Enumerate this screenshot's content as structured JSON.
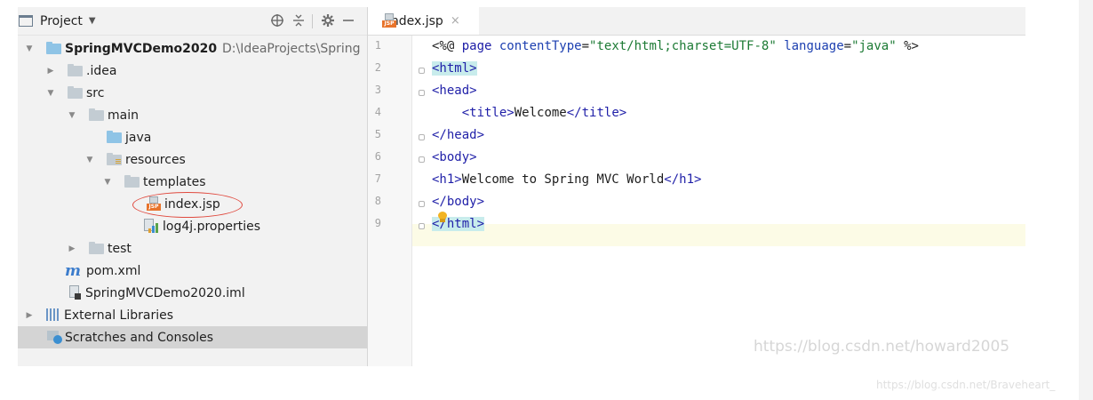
{
  "project_panel": {
    "title": "Project",
    "toolbar": [
      "locate-icon",
      "collapse-icon",
      "settings-icon",
      "hide-icon"
    ],
    "tree": [
      {
        "label": "SpringMVCDemo2020",
        "path": "D:\\IdeaProjects\\Spring",
        "type": "module-folder",
        "expanded": true
      },
      {
        "label": ".idea",
        "type": "folder",
        "expanded": false
      },
      {
        "label": "src",
        "type": "folder",
        "expanded": true
      },
      {
        "label": "main",
        "type": "folder",
        "expanded": true
      },
      {
        "label": "java",
        "type": "source-folder"
      },
      {
        "label": "resources",
        "type": "resources-folder",
        "expanded": true
      },
      {
        "label": "templates",
        "type": "folder",
        "expanded": true
      },
      {
        "label": "index.jsp",
        "type": "jsp-file"
      },
      {
        "label": "log4j.properties",
        "type": "properties-file"
      },
      {
        "label": "test",
        "type": "folder",
        "expanded": false
      },
      {
        "label": "pom.xml",
        "type": "maven-file"
      },
      {
        "label": "SpringMVCDemo2020.iml",
        "type": "iml-file"
      },
      {
        "label": "External Libraries",
        "type": "libraries",
        "expanded": false
      },
      {
        "label": "Scratches and Consoles",
        "type": "scratches",
        "selected": true
      }
    ]
  },
  "editor": {
    "tab": {
      "label": "index.jsp",
      "close": "×",
      "icon": "jsp-file-icon",
      "icon_text": "JSP"
    },
    "line_numbers": [
      "1",
      "2",
      "3",
      "4",
      "5",
      "6",
      "7",
      "8",
      "9"
    ],
    "lines": [
      "<%@ page contentType=\"text/html;charset=UTF-8\" language=\"java\" %>",
      "<html>",
      "<head>",
      "    <title>Welcome</title>",
      "</head>",
      "<body>",
      "<h1>Welcome to Spring MVC World</h1>",
      "</body>",
      "</html>"
    ],
    "current_line": 9,
    "colors": {
      "tag": "#1f1fa8",
      "string": "#1c7a34",
      "bracket_highlight": "#c8ecec",
      "current_line": "#fcfbe6"
    }
  },
  "watermarks": [
    "https://blog.csdn.net/howard2005",
    "https://blog.csdn.net/Braveheart_"
  ],
  "annotation": {
    "type": "red-ellipse",
    "target": "index.jsp",
    "color": "#e04a3f"
  }
}
